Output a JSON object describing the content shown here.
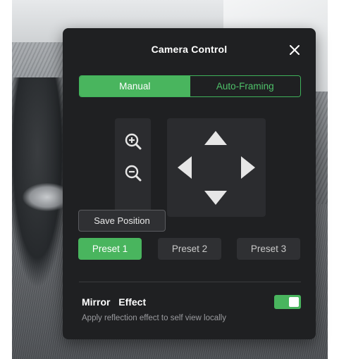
{
  "panel": {
    "title": "Camera Control"
  },
  "modes": {
    "manual_label": "Manual",
    "auto_label": "Auto-Framing",
    "selected": "Manual"
  },
  "tooltip": {
    "text": "Save Position"
  },
  "presets": [
    {
      "label": "Preset 1",
      "active": true
    },
    {
      "label": "Preset 2",
      "active": false
    },
    {
      "label": "Preset 3",
      "active": false
    }
  ],
  "mirror": {
    "label": "Mirror  Effect",
    "description": "Apply reflection effect to self view locally",
    "enabled": true
  },
  "icons": {
    "close": "close-icon",
    "zoom_in": "zoom-in-icon",
    "zoom_out": "zoom-out-icon",
    "pan_up": "arrow-up-icon",
    "pan_down": "arrow-down-icon",
    "pan_left": "arrow-left-icon",
    "pan_right": "arrow-right-icon"
  },
  "colors": {
    "accent": "#49b55e",
    "panel_bg": "#1f2022",
    "control_bg": "#2b2c2f"
  }
}
